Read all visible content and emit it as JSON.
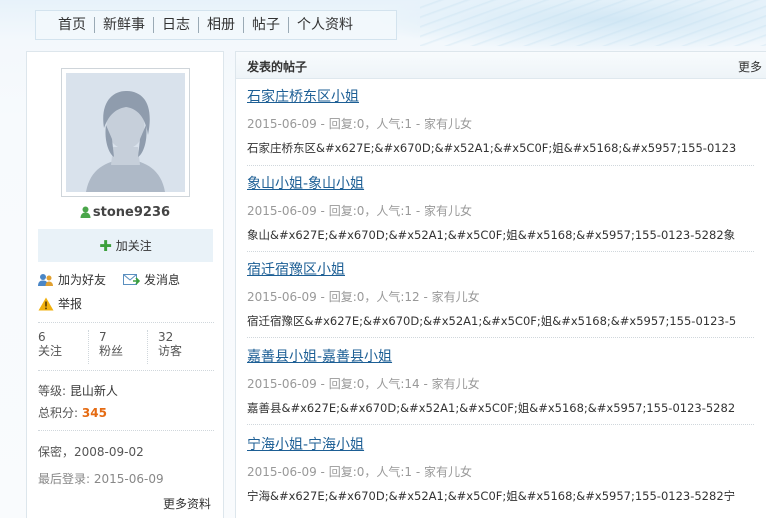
{
  "nav": {
    "items": [
      "首页",
      "新鲜事",
      "日志",
      "相册",
      "帖子",
      "个人资料"
    ]
  },
  "profile": {
    "username": "stone9236",
    "follow_label": "加关注",
    "add_friend_label": "加为好友",
    "message_label": "发消息",
    "report_label": "举报",
    "stats": [
      {
        "value": "6",
        "label": "关注"
      },
      {
        "value": "7",
        "label": "粉丝"
      },
      {
        "value": "32",
        "label": "访客"
      }
    ],
    "level_label": "等级:",
    "level_value": "昆山新人",
    "points_label": "总积分:",
    "points_value": "345",
    "birthday": "保密，2008-09-02",
    "last_login_label": "最后登录:",
    "last_login_value": "2015-06-09",
    "more_profile_label": "更多资料"
  },
  "posts_panel": {
    "title": "发表的帖子",
    "more_label": "更多",
    "posts": [
      {
        "title": "石家庄桥东区小姐",
        "meta": "2015-06-09 - 回复:0，人气:1 - 家有儿女",
        "excerpt": "石家庄桥东区&#x627E;&#x670D;&#x52A1;&#x5C0F;姐&#x5168;&#x5957;155-0123"
      },
      {
        "title": "象山小姐-象山小姐",
        "meta": "2015-06-09 - 回复:0，人气:1 - 家有儿女",
        "excerpt": "象山&#x627E;&#x670D;&#x52A1;&#x5C0F;姐&#x5168;&#x5957;155-0123-5282象"
      },
      {
        "title": "宿迁宿豫区小姐",
        "meta": "2015-06-09 - 回复:0，人气:12 - 家有儿女",
        "excerpt": "宿迁宿豫区&#x627E;&#x670D;&#x52A1;&#x5C0F;姐&#x5168;&#x5957;155-0123-5"
      },
      {
        "title": "嘉善县小姐-嘉善县小姐",
        "meta": "2015-06-09 - 回复:0，人气:14 - 家有儿女",
        "excerpt": "嘉善县&#x627E;&#x670D;&#x52A1;&#x5C0F;姐&#x5168;&#x5957;155-0123-5282"
      },
      {
        "title": "宁海小姐-宁海小姐",
        "meta": "2015-06-09 - 回复:0，人气:1 - 家有儿女",
        "excerpt": "宁海&#x627E;&#x670D;&#x52A1;&#x5C0F;姐&#x5168;&#x5957;155-0123-5282宁"
      }
    ]
  },
  "colors": {
    "link": "#1d5f95",
    "points": "#e56b13",
    "follow_bg": "#e9f2f8"
  },
  "icons": [
    "user-green-icon",
    "plus-icon",
    "add-friend-icon",
    "message-icon",
    "warning-icon",
    "default-avatar"
  ]
}
